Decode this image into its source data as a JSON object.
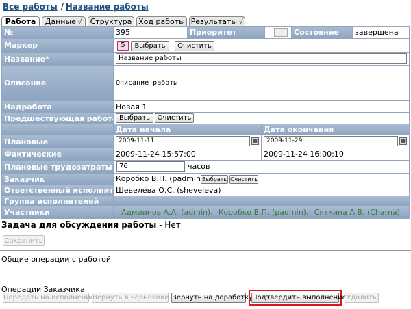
{
  "breadcrumb": {
    "root": "Все работы",
    "separator": "/",
    "current": "Название работы"
  },
  "tabs": [
    {
      "label": "Работа",
      "check": ""
    },
    {
      "label": "Данные",
      "check": "√"
    },
    {
      "label": "Структура",
      "check": ""
    },
    {
      "label": "Ход работы",
      "check": ""
    },
    {
      "label": "Результаты",
      "check": "√"
    }
  ],
  "labels": {
    "number": "№",
    "priority": "Приоритет",
    "state": "Состояние",
    "marker": "Маркер",
    "name": "Название*",
    "description": "Описание",
    "parent": "Надработа",
    "predecessor": "Предшествующая работа",
    "start_date": "Дата начала",
    "end_date": "Дата окончания",
    "planned": "Плановые",
    "actual": "Фактические",
    "planned_effort": "Плановые трудозатраты",
    "customer": "Заказчик",
    "responsible": "Ответственный исполнитель",
    "group": "Группа исполнителей",
    "participants": "Участники"
  },
  "values": {
    "number": "395",
    "state": "завершена",
    "marker": "5",
    "name": "Название работы",
    "description": "Описание работы",
    "parent": "Новая 1",
    "planned_start": "2009-11-11",
    "planned_end": "2009-11-29",
    "actual_start": "2009-11-24 15:57:00",
    "actual_end": "2009-11-24 16:00:10",
    "effort": "76",
    "effort_unit": "часов",
    "customer": "Коробко В.П. (padmin)",
    "responsible": "Шевелева О.С. (sheveleva)",
    "participants": [
      "Адмиинов А.А. (admin),",
      "Коробко В.П. (padmin),",
      "Сяткина А.В. (Charna)"
    ]
  },
  "buttons": {
    "select": "Выбрать",
    "clear": "Очистить",
    "save": "Сохранить",
    "transfer": "Передать на исполнение",
    "return_draft": "Вернуть в черновики",
    "return_rework": "Вернуть на доработку",
    "confirm": "Подтвердить выполнение",
    "delete": "Удалить"
  },
  "discussion": {
    "label": "Задача для обсуждения работы",
    "value": "- Нет"
  },
  "sections": {
    "common": "Общие операции с работой",
    "customer_ops": "Операции Заказчика"
  },
  "colors": {
    "label_bg": "#9bb0c9",
    "link": "#1d4f80",
    "highlight": "#e0141b",
    "marker_border": "#c0306a"
  }
}
